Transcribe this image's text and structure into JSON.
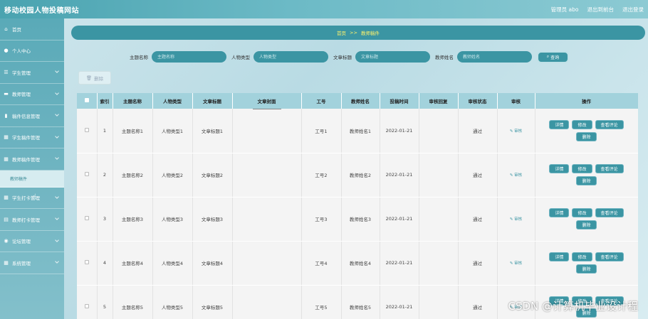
{
  "header": {
    "site_title": "移动校园人物投稿网站",
    "admin_label": "管理员 abo",
    "exit_to_front": "退出到前台",
    "logout": "退出登录"
  },
  "sidebar": {
    "items": [
      {
        "icon": "home-icon",
        "glyph": "⌂",
        "label": "首页"
      },
      {
        "icon": "user-icon",
        "glyph": "●",
        "label": "个人中心"
      },
      {
        "icon": "list-icon",
        "glyph": "☰",
        "label": "学生管理"
      },
      {
        "icon": "monitor-icon",
        "glyph": "▬",
        "label": "教师管理"
      },
      {
        "icon": "bar-chart-icon",
        "glyph": "▮",
        "label": "稿件信息管理"
      },
      {
        "icon": "grid-icon",
        "glyph": "▦",
        "label": "学生稿件管理"
      },
      {
        "icon": "grid-icon",
        "glyph": "▦",
        "label": "教师稿件管理"
      },
      {
        "icon": "grid-icon",
        "glyph": "▦",
        "label": "学生打卡管理"
      },
      {
        "icon": "table-icon",
        "glyph": "▤",
        "label": "教师打卡管理"
      },
      {
        "icon": "chat-icon",
        "glyph": "◉",
        "label": "论坛管理"
      },
      {
        "icon": "grid-icon",
        "glyph": "▦",
        "label": "系统管理"
      }
    ],
    "submenu_label": "教师稿件"
  },
  "breadcrumb": {
    "home": "首页",
    "separator": ">>",
    "current": "教师稿件"
  },
  "search": {
    "topic_label": "主题名称",
    "topic_placeholder": "主题名称",
    "persontype_label": "人物类型",
    "persontype_placeholder": "人物类型",
    "article_label": "文章标题",
    "article_placeholder": "文章标题",
    "teacher_label": "教师姓名",
    "teacher_placeholder": "教师姓名",
    "search_button": "查询"
  },
  "toolbar": {
    "delete_button": "删除"
  },
  "table": {
    "headers": [
      "",
      "索引",
      "主题名称",
      "人物类型",
      "文章标题",
      "文章封面",
      "工号",
      "教师姓名",
      "投稿时间",
      "审核回复",
      "审核状态",
      "审核",
      "操作"
    ],
    "audit_link": "审核",
    "op_buttons": {
      "detail": "详情",
      "edit": "修改",
      "comments": "查看评论",
      "delete": "删除"
    },
    "rows": [
      {
        "index": "1",
        "topic": "主题名称1",
        "persontype": "人物类型1",
        "title": "文章标题1",
        "job_no": "工号1",
        "teacher": "教师姓名1",
        "date": "2022-01-21",
        "reply": "",
        "status": "通过"
      },
      {
        "index": "2",
        "topic": "主题名称2",
        "persontype": "人物类型2",
        "title": "文章标题2",
        "job_no": "工号2",
        "teacher": "教师姓名2",
        "date": "2022-01-21",
        "reply": "",
        "status": "通过"
      },
      {
        "index": "3",
        "topic": "主题名称3",
        "persontype": "人物类型3",
        "title": "文章标题3",
        "job_no": "工号3",
        "teacher": "教师姓名3",
        "date": "2022-01-21",
        "reply": "",
        "status": "通过"
      },
      {
        "index": "4",
        "topic": "主题名称4",
        "persontype": "人物类型4",
        "title": "文章标题4",
        "job_no": "工号4",
        "teacher": "教师姓名4",
        "date": "2022-01-21",
        "reply": "",
        "status": "通过"
      },
      {
        "index": "5",
        "topic": "主题名称5",
        "persontype": "人物类型5",
        "title": "文章标题5",
        "job_no": "工号5",
        "teacher": "教师姓名5",
        "date": "2022-01-21",
        "reply": "",
        "status": "通过"
      }
    ]
  },
  "watermark": "CSDN @计算机毕业设计程"
}
